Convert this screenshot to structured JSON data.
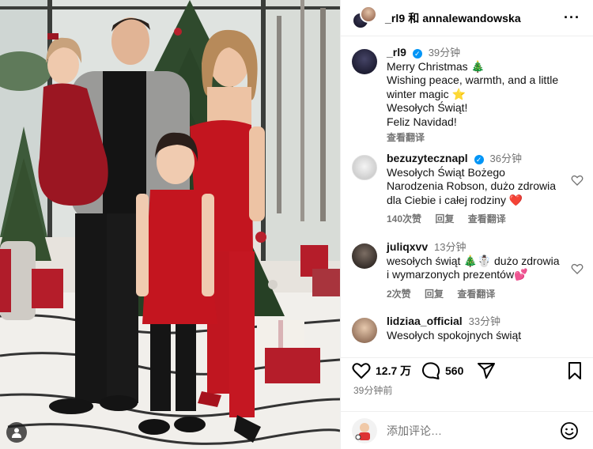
{
  "post": {
    "header_title": "_rl9 和 annalewandowska",
    "more_label": "···"
  },
  "caption": {
    "user": "_rl9",
    "time": "39分钟",
    "lines": [
      "Merry Christmas 🎄",
      "Wishing peace, warmth, and a little",
      "winter magic ⭐",
      "Wesołych Świąt!",
      "Feliz Navidad!"
    ],
    "translate": "查看翻译"
  },
  "comments": [
    {
      "user": "bezuzytecznapl",
      "verified": true,
      "time": "36分钟",
      "lines": [
        "Wesołych Świąt Bożego",
        "Narodzenia Robson, dużo zdrowia",
        "dla Ciebie i całej rodziny ❤️"
      ],
      "likes": "140次赞",
      "reply": "回复",
      "translate": "查看翻译"
    },
    {
      "user": "juliqxvv",
      "verified": false,
      "time": "13分钟",
      "lines": [
        "wesołych świąt 🎄☃️ dużo zdrowia",
        "i wymarzonych prezentów💕"
      ],
      "likes": "2次赞",
      "reply": "回复",
      "translate": "查看翻译"
    },
    {
      "user": "lidziaa_official",
      "verified": false,
      "time": "33分钟",
      "lines": [
        "Wesołych spokojnych świąt"
      ]
    }
  ],
  "actions": {
    "likes_count": "12.7 万",
    "comments_count": "560",
    "time_ago": "39分钟前"
  },
  "add_comment": {
    "placeholder": "添加评论…"
  },
  "icons": {
    "like": "heart-icon",
    "comment": "comment-icon",
    "share": "share-icon",
    "save": "bookmark-icon",
    "tagged": "user-tag-icon",
    "emoji": "emoji-icon"
  },
  "colors": {
    "verified": "#0095f6",
    "heart_red": "#ed4956",
    "muted": "#737373"
  }
}
